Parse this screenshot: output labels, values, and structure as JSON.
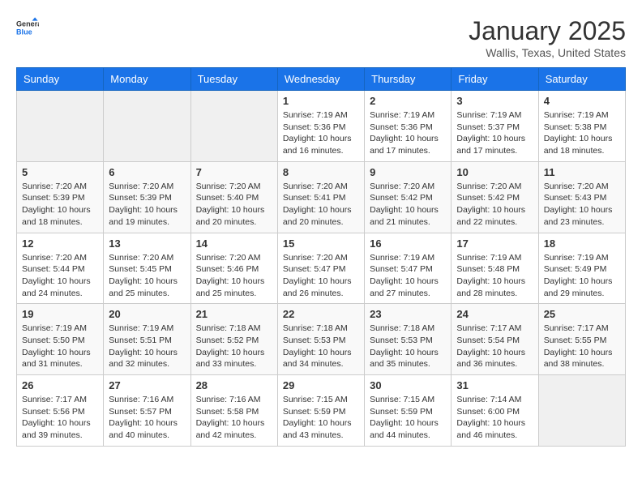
{
  "logo": {
    "line1": "General",
    "line2": "Blue"
  },
  "header": {
    "title": "January 2025",
    "subtitle": "Wallis, Texas, United States"
  },
  "weekdays": [
    "Sunday",
    "Monday",
    "Tuesday",
    "Wednesday",
    "Thursday",
    "Friday",
    "Saturday"
  ],
  "weeks": [
    [
      {
        "day": "",
        "info": ""
      },
      {
        "day": "",
        "info": ""
      },
      {
        "day": "",
        "info": ""
      },
      {
        "day": "1",
        "info": "Sunrise: 7:19 AM\nSunset: 5:36 PM\nDaylight: 10 hours\nand 16 minutes."
      },
      {
        "day": "2",
        "info": "Sunrise: 7:19 AM\nSunset: 5:36 PM\nDaylight: 10 hours\nand 17 minutes."
      },
      {
        "day": "3",
        "info": "Sunrise: 7:19 AM\nSunset: 5:37 PM\nDaylight: 10 hours\nand 17 minutes."
      },
      {
        "day": "4",
        "info": "Sunrise: 7:19 AM\nSunset: 5:38 PM\nDaylight: 10 hours\nand 18 minutes."
      }
    ],
    [
      {
        "day": "5",
        "info": "Sunrise: 7:20 AM\nSunset: 5:39 PM\nDaylight: 10 hours\nand 18 minutes."
      },
      {
        "day": "6",
        "info": "Sunrise: 7:20 AM\nSunset: 5:39 PM\nDaylight: 10 hours\nand 19 minutes."
      },
      {
        "day": "7",
        "info": "Sunrise: 7:20 AM\nSunset: 5:40 PM\nDaylight: 10 hours\nand 20 minutes."
      },
      {
        "day": "8",
        "info": "Sunrise: 7:20 AM\nSunset: 5:41 PM\nDaylight: 10 hours\nand 20 minutes."
      },
      {
        "day": "9",
        "info": "Sunrise: 7:20 AM\nSunset: 5:42 PM\nDaylight: 10 hours\nand 21 minutes."
      },
      {
        "day": "10",
        "info": "Sunrise: 7:20 AM\nSunset: 5:42 PM\nDaylight: 10 hours\nand 22 minutes."
      },
      {
        "day": "11",
        "info": "Sunrise: 7:20 AM\nSunset: 5:43 PM\nDaylight: 10 hours\nand 23 minutes."
      }
    ],
    [
      {
        "day": "12",
        "info": "Sunrise: 7:20 AM\nSunset: 5:44 PM\nDaylight: 10 hours\nand 24 minutes."
      },
      {
        "day": "13",
        "info": "Sunrise: 7:20 AM\nSunset: 5:45 PM\nDaylight: 10 hours\nand 25 minutes."
      },
      {
        "day": "14",
        "info": "Sunrise: 7:20 AM\nSunset: 5:46 PM\nDaylight: 10 hours\nand 25 minutes."
      },
      {
        "day": "15",
        "info": "Sunrise: 7:20 AM\nSunset: 5:47 PM\nDaylight: 10 hours\nand 26 minutes."
      },
      {
        "day": "16",
        "info": "Sunrise: 7:19 AM\nSunset: 5:47 PM\nDaylight: 10 hours\nand 27 minutes."
      },
      {
        "day": "17",
        "info": "Sunrise: 7:19 AM\nSunset: 5:48 PM\nDaylight: 10 hours\nand 28 minutes."
      },
      {
        "day": "18",
        "info": "Sunrise: 7:19 AM\nSunset: 5:49 PM\nDaylight: 10 hours\nand 29 minutes."
      }
    ],
    [
      {
        "day": "19",
        "info": "Sunrise: 7:19 AM\nSunset: 5:50 PM\nDaylight: 10 hours\nand 31 minutes."
      },
      {
        "day": "20",
        "info": "Sunrise: 7:19 AM\nSunset: 5:51 PM\nDaylight: 10 hours\nand 32 minutes."
      },
      {
        "day": "21",
        "info": "Sunrise: 7:18 AM\nSunset: 5:52 PM\nDaylight: 10 hours\nand 33 minutes."
      },
      {
        "day": "22",
        "info": "Sunrise: 7:18 AM\nSunset: 5:53 PM\nDaylight: 10 hours\nand 34 minutes."
      },
      {
        "day": "23",
        "info": "Sunrise: 7:18 AM\nSunset: 5:53 PM\nDaylight: 10 hours\nand 35 minutes."
      },
      {
        "day": "24",
        "info": "Sunrise: 7:17 AM\nSunset: 5:54 PM\nDaylight: 10 hours\nand 36 minutes."
      },
      {
        "day": "25",
        "info": "Sunrise: 7:17 AM\nSunset: 5:55 PM\nDaylight: 10 hours\nand 38 minutes."
      }
    ],
    [
      {
        "day": "26",
        "info": "Sunrise: 7:17 AM\nSunset: 5:56 PM\nDaylight: 10 hours\nand 39 minutes."
      },
      {
        "day": "27",
        "info": "Sunrise: 7:16 AM\nSunset: 5:57 PM\nDaylight: 10 hours\nand 40 minutes."
      },
      {
        "day": "28",
        "info": "Sunrise: 7:16 AM\nSunset: 5:58 PM\nDaylight: 10 hours\nand 42 minutes."
      },
      {
        "day": "29",
        "info": "Sunrise: 7:15 AM\nSunset: 5:59 PM\nDaylight: 10 hours\nand 43 minutes."
      },
      {
        "day": "30",
        "info": "Sunrise: 7:15 AM\nSunset: 5:59 PM\nDaylight: 10 hours\nand 44 minutes."
      },
      {
        "day": "31",
        "info": "Sunrise: 7:14 AM\nSunset: 6:00 PM\nDaylight: 10 hours\nand 46 minutes."
      },
      {
        "day": "",
        "info": ""
      }
    ]
  ]
}
